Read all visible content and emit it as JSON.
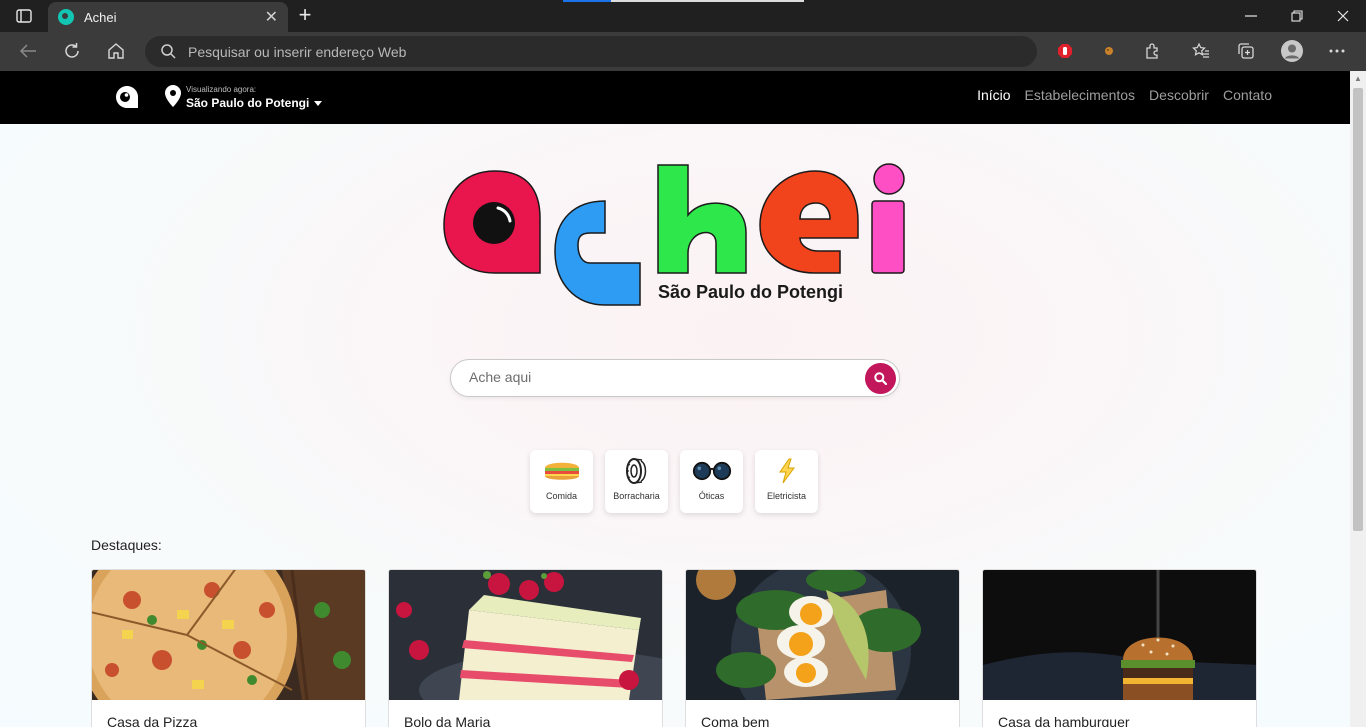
{
  "browser": {
    "tab_title": "Achei",
    "address_placeholder": "Pesquisar ou inserir endereço Web"
  },
  "navbar": {
    "viewing_label": "Visualizando agora:",
    "city": "São Paulo do Potengi",
    "links": [
      {
        "label": "Início",
        "active": true
      },
      {
        "label": "Estabelecimentos",
        "active": false
      },
      {
        "label": "Descobrir",
        "active": false
      },
      {
        "label": "Contato",
        "active": false
      }
    ]
  },
  "hero": {
    "brand_letters": [
      "a",
      "c",
      "h",
      "e",
      "i"
    ],
    "brand_colors": [
      "#e8164d",
      "#2e9cf2",
      "#2ee84b",
      "#f2441c",
      "#ff4fc4"
    ],
    "city": "São Paulo do Potengi",
    "search_placeholder": "Ache aqui",
    "search_button_color": "#c2185b"
  },
  "categories": [
    {
      "label": "Comida",
      "icon": "sandwich-icon"
    },
    {
      "label": "Borracharia",
      "icon": "tire-icon"
    },
    {
      "label": "Óticas",
      "icon": "glasses-icon"
    },
    {
      "label": "Eletricista",
      "icon": "lightning-icon"
    }
  ],
  "highlights": {
    "title": "Destaques:",
    "cards": [
      {
        "name": "Casa da Pizza",
        "image": "pizza-photo"
      },
      {
        "name": "Bolo da Maria",
        "image": "cake-photo"
      },
      {
        "name": "Coma bem",
        "image": "eggs-toast-photo"
      },
      {
        "name": "Casa da hamburguer",
        "image": "burger-photo"
      }
    ]
  }
}
